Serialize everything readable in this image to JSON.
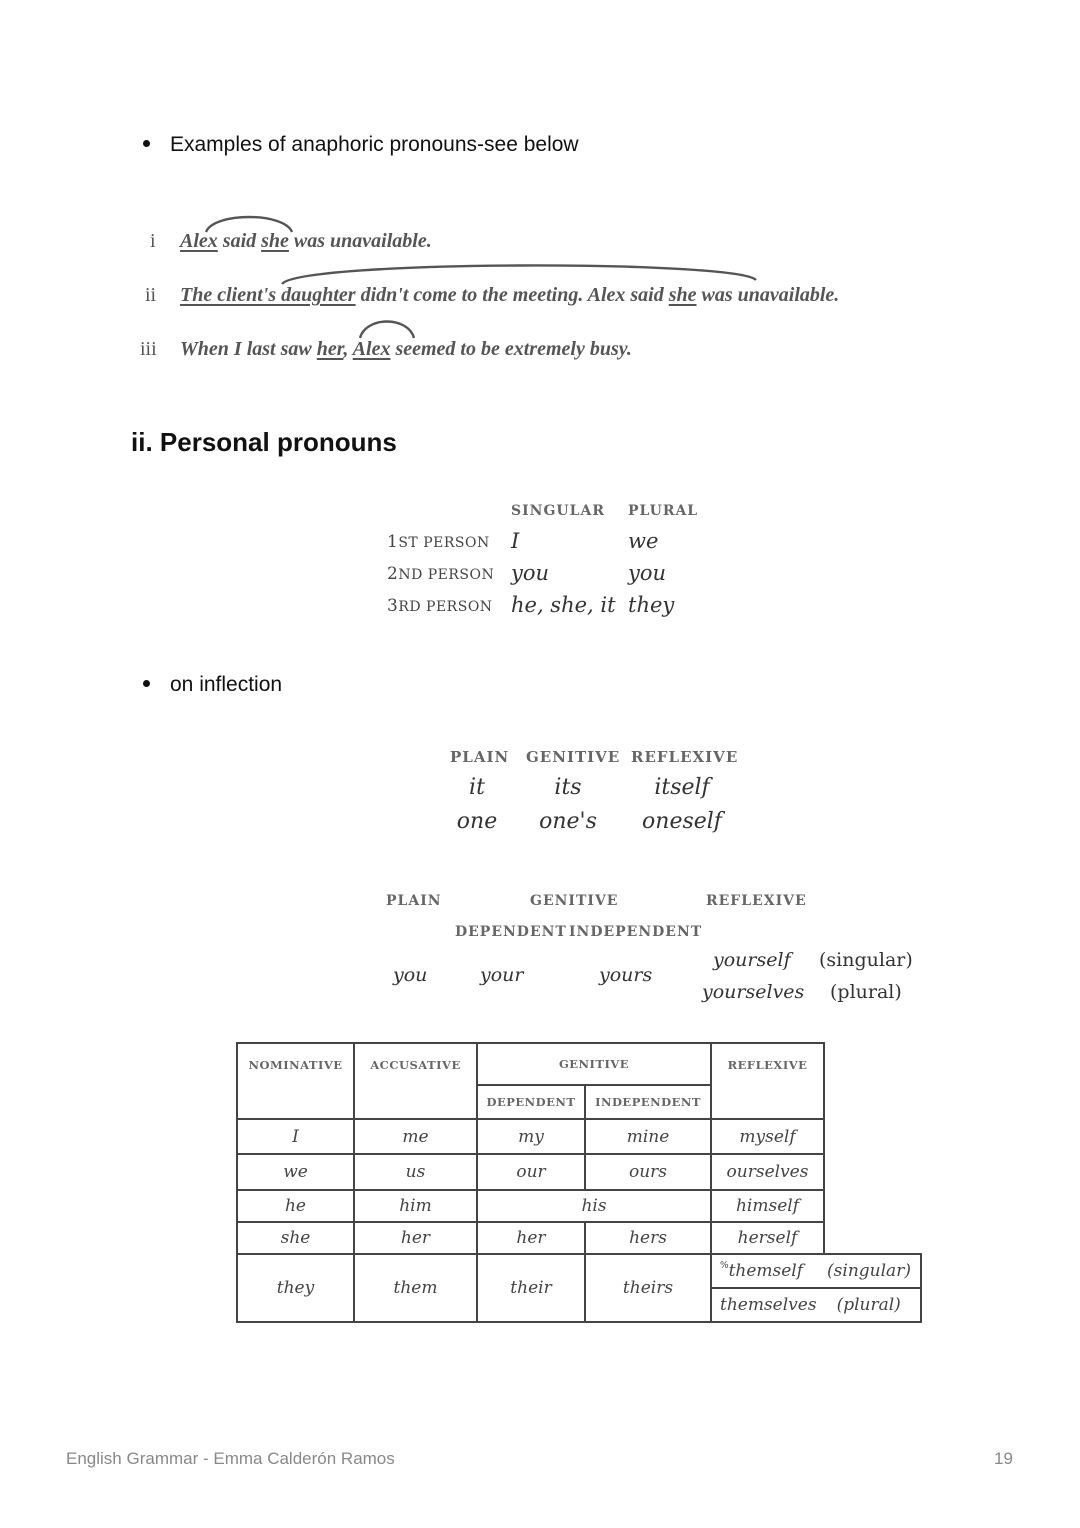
{
  "bullets": {
    "anaphoric": "Examples of anaphoric pronouns-see below",
    "inflection": "on inflection"
  },
  "examples": [
    {
      "num": "i",
      "parts": [
        "Alex",
        " said ",
        "she",
        " was unavailable."
      ]
    },
    {
      "num": "ii",
      "parts": [
        "The client's daughter",
        " didn't come to the meeting. Alex said ",
        "she",
        " was unavailable."
      ]
    },
    {
      "num": "iii",
      "parts": [
        "When I last saw ",
        "her",
        ", ",
        "Alex",
        " seemed to be extremely busy."
      ]
    }
  ],
  "section": {
    "heading": "ii. Personal pronouns"
  },
  "person_table": {
    "col_headers": [
      "SINGULAR",
      "PLURAL"
    ],
    "rows": [
      {
        "label_num": "1",
        "label_rest": "ST PERSON",
        "singular": "I",
        "plural": "we"
      },
      {
        "label_num": "2",
        "label_rest": "ND PERSON",
        "singular": "you",
        "plural": "you"
      },
      {
        "label_num": "3",
        "label_rest": "RD PERSON",
        "singular": "he, she, it",
        "plural": "they"
      }
    ]
  },
  "it_one_table": {
    "headers": [
      "PLAIN",
      "GENITIVE",
      "REFLEXIVE"
    ],
    "rows": [
      [
        "it",
        "its",
        "itself"
      ],
      [
        "one",
        "one's",
        "oneself"
      ]
    ]
  },
  "you_table": {
    "headers": {
      "plain": "PLAIN",
      "genitive": "GENITIVE",
      "dependent": "DEPENDENT",
      "independent": "INDEPENDENT",
      "reflexive": "REFLEXIVE"
    },
    "plain": "you",
    "dependent": "your",
    "independent": "yours",
    "reflexive": [
      {
        "form": "yourself",
        "note": "(singular)"
      },
      {
        "form": "yourselves",
        "note": "(plural)"
      }
    ]
  },
  "case_table": {
    "headers": {
      "nominative": "NOMINATIVE",
      "accusative": "ACCUSATIVE",
      "genitive": "GENITIVE",
      "dependent": "DEPENDENT",
      "independent": "INDEPENDENT",
      "reflexive": "REFLEXIVE"
    },
    "rows": [
      {
        "nom": "I",
        "acc": "me",
        "dep": "my",
        "indep": "mine",
        "refl": "myself"
      },
      {
        "nom": "we",
        "acc": "us",
        "dep": "our",
        "indep": "ours",
        "refl": "ourselves"
      },
      {
        "nom": "he",
        "acc": "him",
        "gen_merged": "his",
        "refl": "himself"
      },
      {
        "nom": "she",
        "acc": "her",
        "dep": "her",
        "indep": "hers",
        "refl": "herself"
      },
      {
        "nom": "they",
        "acc": "them",
        "dep": "their",
        "indep": "theirs",
        "refl_variants": [
          {
            "marker": "%",
            "form": "themself",
            "note": "(singular)"
          },
          {
            "form": "themselves",
            "note": "(plural)"
          }
        ]
      }
    ]
  },
  "footer": {
    "left": "English Grammar - Emma Calderón Ramos",
    "page_number": "19"
  }
}
